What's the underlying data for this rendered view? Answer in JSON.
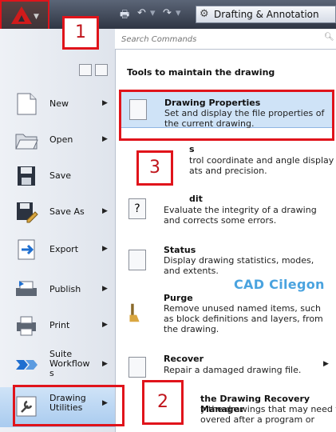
{
  "titlebar": {
    "workspace": "Drafting & Annotation",
    "app_menu_icon": "autocad-logo-icon",
    "quick_access_icons": [
      "print-icon",
      "undo-icon",
      "redo-icon"
    ]
  },
  "search": {
    "placeholder": "Search Commands"
  },
  "left_menu": {
    "items": [
      {
        "label": "New",
        "icon": "new-document-icon",
        "has_arrow": true
      },
      {
        "label": "Open",
        "icon": "open-folder-icon",
        "has_arrow": true
      },
      {
        "label": "Save",
        "icon": "save-icon",
        "has_arrow": false
      },
      {
        "label": "Save As",
        "icon": "save-as-icon",
        "has_arrow": true
      },
      {
        "label": "Export",
        "icon": "export-icon",
        "has_arrow": true
      },
      {
        "label": "Publish",
        "icon": "publish-icon",
        "has_arrow": true
      },
      {
        "label": "Print",
        "icon": "printer-icon",
        "has_arrow": true
      },
      {
        "label": "Suite\nWorkflow\ns",
        "icon": "suite-workflows-icon",
        "has_arrow": true
      },
      {
        "label": "Drawing\nUtilities",
        "icon": "wrench-icon",
        "has_arrow": true,
        "selected": true
      }
    ]
  },
  "panel": {
    "title": "Tools to maintain the drawing",
    "items": [
      {
        "title": "Drawing Properties",
        "desc": "Set and display the file properties of the current drawing.",
        "highlighted": true
      },
      {
        "title": "s",
        "desc": "trol coordinate and angle display\nats and precision."
      },
      {
        "title": "dit",
        "desc": "Evaluate the integrity of a drawing and corrects some errors."
      },
      {
        "title": "Status",
        "desc": "Display drawing statistics, modes, and extents."
      },
      {
        "title": "Purge",
        "desc": "Remove unused named items, such as block definitions and layers, from the drawing."
      },
      {
        "title": "Recover",
        "desc": "Repair a damaged drawing file.",
        "has_arrow": true
      },
      {
        "title": "the Drawing Recovery Manager",
        "desc": "y the drawings that may need to\novered after a program or"
      }
    ]
  },
  "watermark": "CAD Cilegon",
  "callouts": [
    "1",
    "2",
    "3"
  ],
  "colors": {
    "callout_red": "#e0141b",
    "highlight_blue": "#cfe3f7",
    "watermark_blue": "#4aa3df"
  }
}
